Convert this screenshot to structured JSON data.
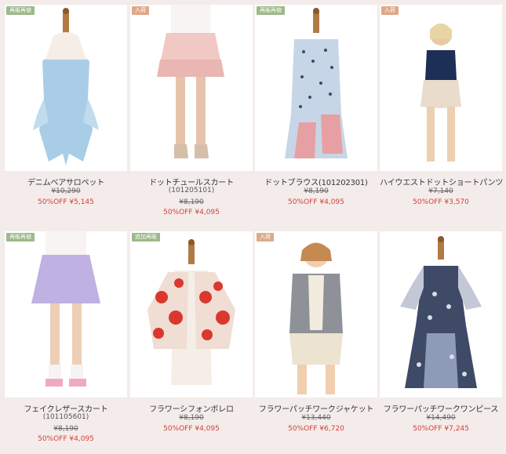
{
  "products": [
    {
      "tag": "再販再値",
      "tag_color": "green",
      "name": "デニムベアサロペット",
      "code": "",
      "old_price": "¥10,290",
      "sale": "50%OFF ¥5,145",
      "icon": "dress-mannequin-icon"
    },
    {
      "tag": "入荷",
      "tag_color": "peach",
      "name": "ドットチュールスカート",
      "code": "(101205101)",
      "old_price": "¥8,190",
      "sale": "50%OFF ¥4,095",
      "icon": "skirt-model-icon"
    },
    {
      "tag": "再販再値",
      "tag_color": "green",
      "name": "ドットブラウス(101202301)",
      "code": "",
      "old_price": "¥8,190",
      "sale": "50%OFF ¥4,095",
      "icon": "blouse-mannequin-icon"
    },
    {
      "tag": "入荷",
      "tag_color": "peach",
      "name": "ハイウエストドットショートパンツ",
      "code": "",
      "old_price": "¥7,140",
      "sale": "50%OFF ¥3,570",
      "icon": "shorts-model-icon"
    },
    {
      "tag": "再販再値",
      "tag_color": "green",
      "name": "フェイクレザースカート",
      "code": "(101105601)",
      "old_price": "¥8,190",
      "sale": "50%OFF ¥4,095",
      "icon": "skirt-model-icon"
    },
    {
      "tag": "追加再販",
      "tag_color": "green",
      "name": "フラワーシフォンボレロ",
      "code": "",
      "old_price": "¥8,190",
      "sale": "50%OFF ¥4,095",
      "icon": "bolero-mannequin-icon"
    },
    {
      "tag": "入荷",
      "tag_color": "peach",
      "name": "フラワーパッチワークジャケット",
      "code": "",
      "old_price": "¥13,440",
      "sale": "50%OFF ¥6,720",
      "icon": "jacket-model-icon"
    },
    {
      "tag": "",
      "tag_color": "",
      "name": "フラワーパッチワークワンピース",
      "code": "",
      "old_price": "¥14,490",
      "sale": "50%OFF ¥7,245",
      "icon": "dress-mannequin-icon"
    }
  ],
  "colors": {
    "accent": "#d8403a",
    "background": "#f3ecea",
    "tag_green": "#9cb98a",
    "tag_peach": "#dfa889"
  }
}
